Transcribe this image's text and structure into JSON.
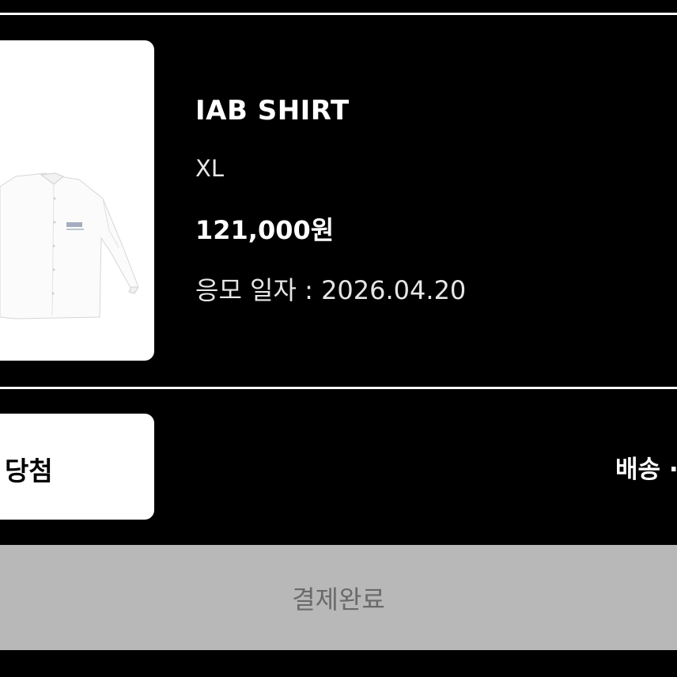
{
  "product": {
    "name": "IAB SHIRT",
    "size": "XL",
    "price": "121,000원",
    "entry_date_label": "응모 일자 :",
    "entry_date_value": "2026.04.20",
    "image_icon": "shirt-image"
  },
  "result": {
    "label": "당첨"
  },
  "delivery": {
    "label": "배송 ·"
  },
  "payment": {
    "button_label": "결제완료"
  },
  "colors": {
    "background": "#000000",
    "card": "#ffffff",
    "button_bg": "#b8b8b8",
    "button_text": "#6a6a6a"
  }
}
